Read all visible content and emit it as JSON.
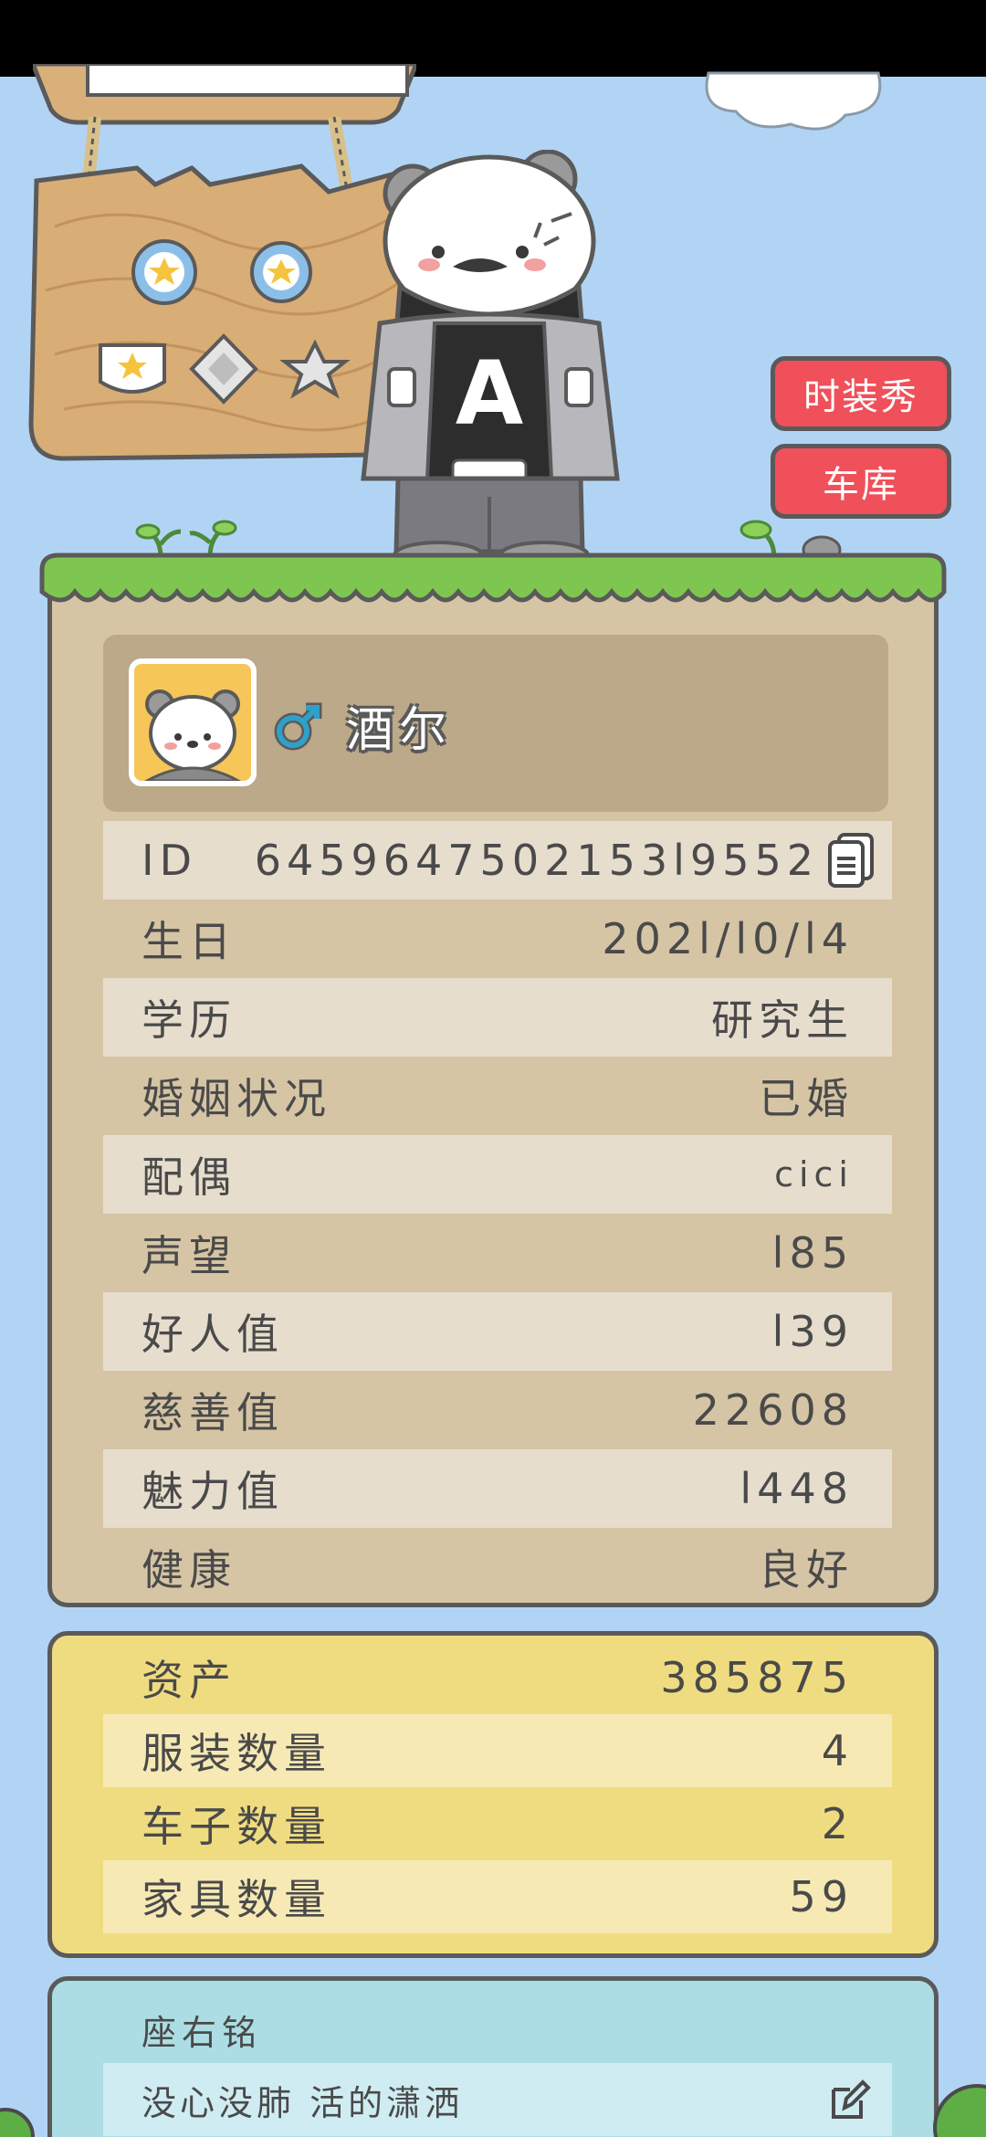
{
  "header": {
    "fashion_button": "时装秀",
    "garage_button": "车库"
  },
  "profile": {
    "name": "酒尔",
    "gender": "male",
    "info_rows": [
      {
        "label": "ID",
        "value": "6459647502153l9552"
      },
      {
        "label": "生日",
        "value": "202l/l0/l4"
      },
      {
        "label": "学历",
        "value": "研究生"
      },
      {
        "label": "婚姻状况",
        "value": "已婚"
      },
      {
        "label": "配偶",
        "value": "cici"
      },
      {
        "label": "声望",
        "value": "l85"
      },
      {
        "label": "好人值",
        "value": "l39"
      },
      {
        "label": "慈善值",
        "value": "22608"
      },
      {
        "label": "魅力值",
        "value": "l448"
      },
      {
        "label": "健康",
        "value": "良好"
      }
    ]
  },
  "assets": {
    "rows": [
      {
        "label": "资产",
        "value": "385875"
      },
      {
        "label": "服装数量",
        "value": "4"
      },
      {
        "label": "车子数量",
        "value": "2"
      },
      {
        "label": "家具数量",
        "value": "59"
      }
    ]
  },
  "motto": {
    "title": "座右铭",
    "text": "没心没肺 活的潇洒"
  },
  "icons": {
    "copy": "copy-icon",
    "edit": "edit-icon",
    "gender": "male-symbol-icon"
  },
  "colors": {
    "sky": "#b2d4f4",
    "card_beige": "#d5c5a5",
    "card_yellow": "#f0dc80",
    "card_blue": "#acdde4",
    "button_red": "#f0505a",
    "gender_blue": "#2fa0c8"
  }
}
